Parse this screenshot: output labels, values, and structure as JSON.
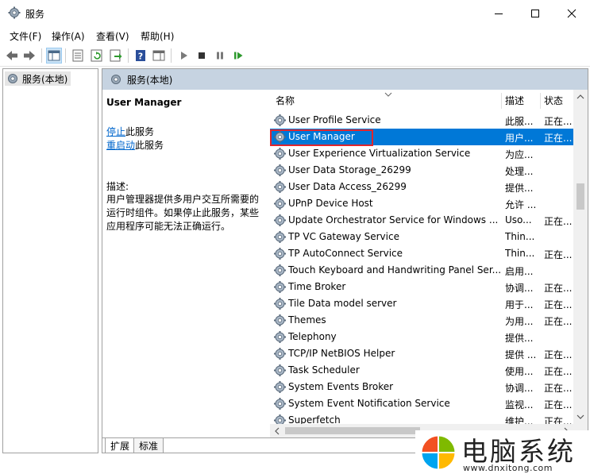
{
  "window": {
    "title": "服务"
  },
  "menu": {
    "file": "文件(F)",
    "action": "操作(A)",
    "view": "查看(V)",
    "help": "帮助(H)"
  },
  "tree": {
    "root_label": "服务(本地)"
  },
  "pane": {
    "header": "服务(本地)"
  },
  "details": {
    "service_name": "User Manager",
    "stop_link": "停止",
    "stop_suffix": "此服务",
    "restart_link": "重启动",
    "restart_suffix": "此服务",
    "desc_label": "描述:",
    "desc_lines": [
      "用户管理器提供多用户交互所需要的",
      "运行时组件。如果停止此服务，某些",
      "应用程序可能无法正确运行。"
    ]
  },
  "columns": {
    "name": "名称",
    "desc": "描述",
    "status": "状态"
  },
  "rows": [
    {
      "name": "User Profile Service",
      "desc": "此服...",
      "status": "正在..."
    },
    {
      "name": "User Manager",
      "desc": "用户...",
      "status": "正在...",
      "selected": true
    },
    {
      "name": "User Experience Virtualization Service",
      "desc": "为应...",
      "status": ""
    },
    {
      "name": "User Data Storage_26299",
      "desc": "处理...",
      "status": ""
    },
    {
      "name": "User Data Access_26299",
      "desc": "提供...",
      "status": ""
    },
    {
      "name": "UPnP Device Host",
      "desc": "允许 ...",
      "status": ""
    },
    {
      "name": "Update Orchestrator Service for Windows ...",
      "desc": "Uso...",
      "status": "正在..."
    },
    {
      "name": "TP VC Gateway Service",
      "desc": "Thin...",
      "status": ""
    },
    {
      "name": "TP AutoConnect Service",
      "desc": "Thin...",
      "status": "正在..."
    },
    {
      "name": "Touch Keyboard and Handwriting Panel Ser...",
      "desc": "启用...",
      "status": ""
    },
    {
      "name": "Time Broker",
      "desc": "协调...",
      "status": "正在..."
    },
    {
      "name": "Tile Data model server",
      "desc": "用于...",
      "status": "正在..."
    },
    {
      "name": "Themes",
      "desc": "为用...",
      "status": "正在..."
    },
    {
      "name": "Telephony",
      "desc": "提供...",
      "status": ""
    },
    {
      "name": "TCP/IP NetBIOS Helper",
      "desc": "提供 ...",
      "status": "正在..."
    },
    {
      "name": "Task Scheduler",
      "desc": "使用...",
      "status": "正在..."
    },
    {
      "name": "System Events Broker",
      "desc": "协调...",
      "status": "正在..."
    },
    {
      "name": "System Event Notification Service",
      "desc": "监视...",
      "status": "正在..."
    },
    {
      "name": "Superfetch",
      "desc": "维护...",
      "status": "正在..."
    }
  ],
  "tabs": {
    "extended": "扩展",
    "standard": "标准"
  },
  "watermark": {
    "text": "电脑系统",
    "url": "www.dnxitong.com"
  },
  "colors": {
    "selection": "#0078d7",
    "pane_header": "#c6d3e1",
    "link": "#0066cc",
    "highlight_box": "#e0262e"
  }
}
